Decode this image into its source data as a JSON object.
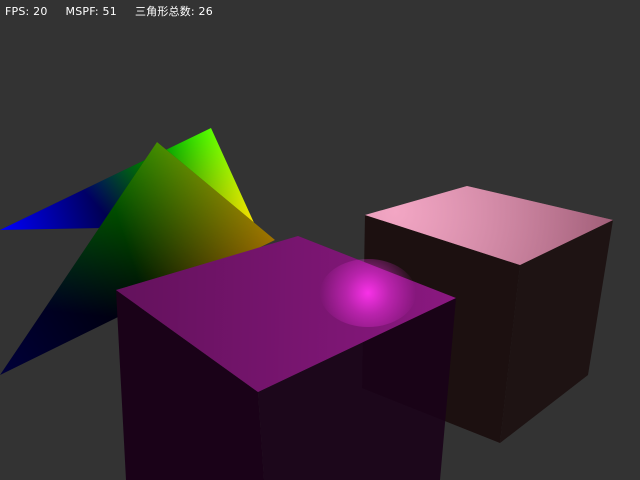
{
  "viewport": {
    "background": "#333333"
  },
  "hud": {
    "fps": "FPS: 20",
    "mspf": "MSPF: 51",
    "triangle_count": "三角形总数: 26"
  },
  "scene": {
    "triangle_back_colors": [
      "#0000ff",
      "#00ff00",
      "#ff7f00"
    ],
    "triangle_front_colors": [
      "#00003a",
      "#008000",
      "#a04000"
    ],
    "pink_cube_top": "#ee88b0",
    "pink_cube_side": "#1c1010",
    "magenta_cube_top": "#8a1880",
    "magenta_cube_side": "#1a0218",
    "specular_highlight": "#ff33ee"
  }
}
